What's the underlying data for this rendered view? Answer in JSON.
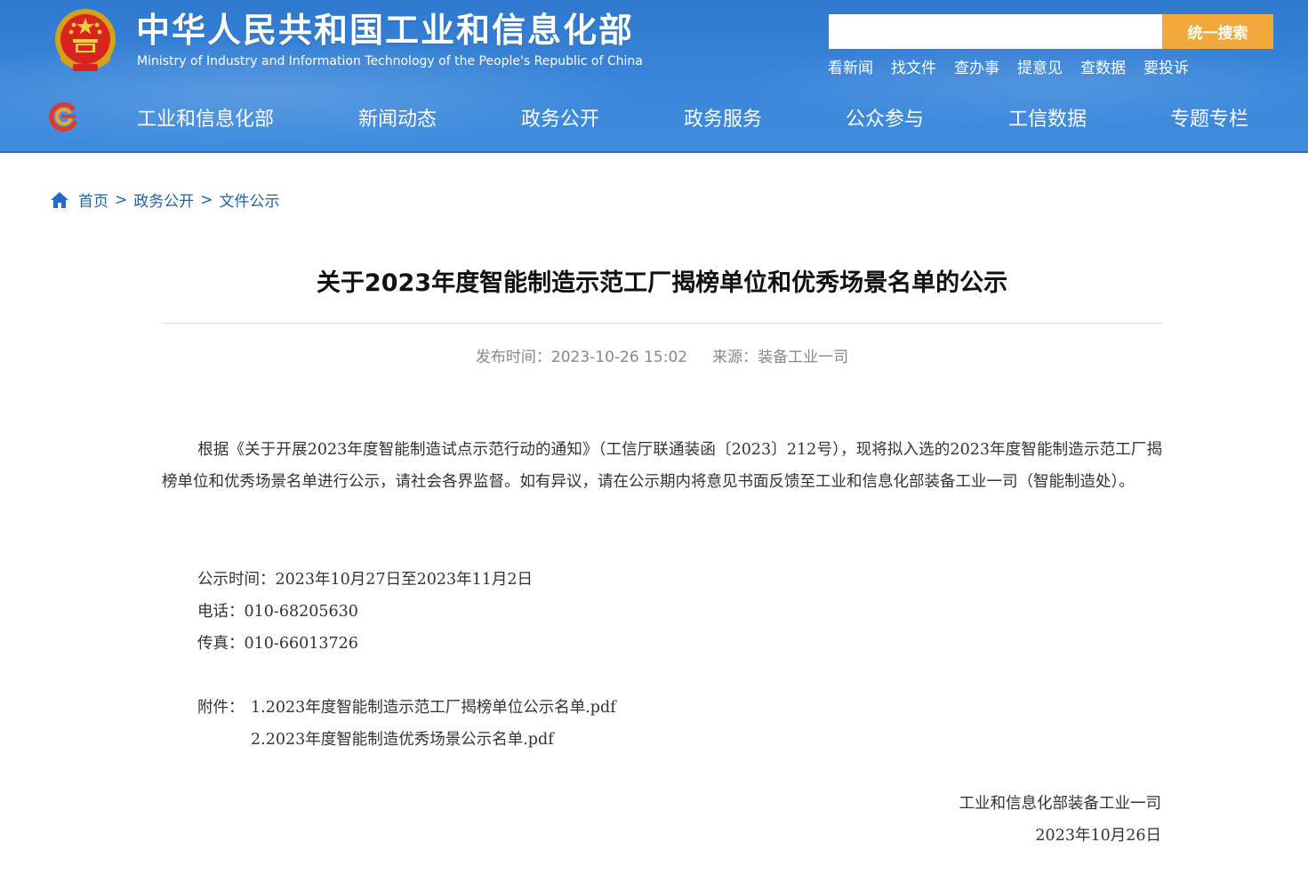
{
  "header": {
    "title": "中华人民共和国工业和信息化部",
    "subtitle": "Ministry of Industry and Information Technology of the People's Republic of China",
    "search": {
      "placeholder": "",
      "button_label": "统一搜索"
    },
    "quick_links": [
      "看新闻",
      "找文件",
      "查办事",
      "提意见",
      "查数据",
      "要投诉"
    ],
    "colors": {
      "header_blue": "#3a86da",
      "search_button": "#f0a93a"
    }
  },
  "nav": {
    "items": [
      "工业和信息化部",
      "新闻动态",
      "政务公开",
      "政务服务",
      "公众参与",
      "工信数据",
      "专题专栏"
    ]
  },
  "breadcrumb": {
    "icon": "home-icon",
    "items": [
      "首页",
      "政务公开",
      "文件公示"
    ],
    "separator": ">"
  },
  "article": {
    "title": "关于2023年度智能制造示范工厂揭榜单位和优秀场景名单的公示",
    "publish_time": "发布时间：2023-10-26 15:02",
    "source": "来源：装备工业一司",
    "paragraph": "根据《关于开展2023年度智能制造试点示范行动的通知》（工信厅联通装函〔2023〕212号），现将拟入选的2023年度智能制造示范工厂揭榜单位和优秀场景名单进行公示，请社会各界监督。如有异议，请在公示期内将意见书面反馈至工业和信息化部装备工业一司（智能制造处）。",
    "notice_period": "公示时间：2023年10月27日至2023年11月2日",
    "phone": "电话：010-68205630",
    "fax": "传真：010-66013726",
    "attachment_label": "附件：",
    "attachments": [
      "1.2023年度智能制造示范工厂揭榜单位公示名单.pdf",
      "2.2023年度智能制造优秀场景公示名单.pdf"
    ],
    "signature_org": "工业和信息化部装备工业一司",
    "signature_date": "2023年10月26日"
  }
}
